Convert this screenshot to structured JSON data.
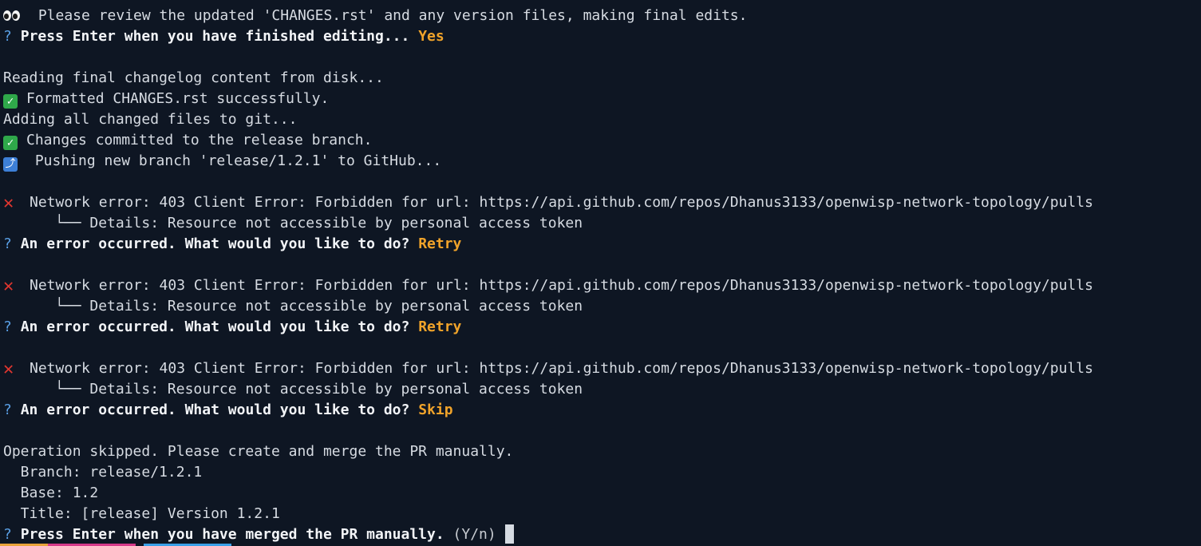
{
  "terminal": {
    "lines": [
      {
        "id": "review",
        "text": " Please review the updated 'CHANGES.rst' and any version files, making final edits."
      },
      {
        "id": "prompt1_q",
        "text": "Press Enter when you have finished editing...",
        "answer": "Yes"
      },
      {
        "id": "reading",
        "text": "Reading final changelog content from disk..."
      },
      {
        "id": "formatted",
        "text": "Formatted CHANGES.rst successfully."
      },
      {
        "id": "adding",
        "text": "Adding all changed files to git..."
      },
      {
        "id": "committed",
        "text": "Changes committed to the release branch."
      },
      {
        "id": "pushing",
        "text": " Pushing new branch 'release/1.2.1' to GitHub..."
      },
      {
        "id": "err1",
        "text": "Network error: 403 Client Error: Forbidden for url: https://api.github.com/repos/Dhanus3133/openwisp-network-topology/pulls"
      },
      {
        "id": "det1",
        "text": "      └── Details: Resource not accessible by personal access token"
      },
      {
        "id": "ask1",
        "text": "An error occurred. What would you like to do?",
        "answer": "Retry"
      },
      {
        "id": "err2",
        "text": "Network error: 403 Client Error: Forbidden for url: https://api.github.com/repos/Dhanus3133/openwisp-network-topology/pulls"
      },
      {
        "id": "det2",
        "text": "      └── Details: Resource not accessible by personal access token"
      },
      {
        "id": "ask2",
        "text": "An error occurred. What would you like to do?",
        "answer": "Retry"
      },
      {
        "id": "err3",
        "text": "Network error: 403 Client Error: Forbidden for url: https://api.github.com/repos/Dhanus3133/openwisp-network-topology/pulls"
      },
      {
        "id": "det3",
        "text": "      └── Details: Resource not accessible by personal access token"
      },
      {
        "id": "ask3",
        "text": "An error occurred. What would you like to do?",
        "answer": "Skip"
      },
      {
        "id": "skipped",
        "text": "Operation skipped. Please create and merge the PR manually."
      },
      {
        "id": "branch",
        "text": "  Branch: release/1.2.1"
      },
      {
        "id": "base",
        "text": "  Base: 1.2"
      },
      {
        "id": "title",
        "text": "  Title: [release] Version 1.2.1"
      },
      {
        "id": "final_q",
        "text": "Press Enter when you have merged the PR manually.",
        "hint": "(Y/n)"
      }
    ],
    "question_mark": "?",
    "check_glyph": "✓",
    "cross_glyph": "✕",
    "push_glyph": "⤴"
  },
  "colors": {
    "background": "#0e1623",
    "text": "#d6dbe2",
    "question": "#5aa0e6",
    "answer": "#f0a32a",
    "check": "#2fa84a",
    "cross": "#e0362f",
    "push": "#3d7fd6"
  },
  "icons": {
    "eyes": "eyes-icon",
    "check": "check-mark-icon",
    "cross": "cross-mark-icon",
    "push": "push-arrow-icon"
  }
}
